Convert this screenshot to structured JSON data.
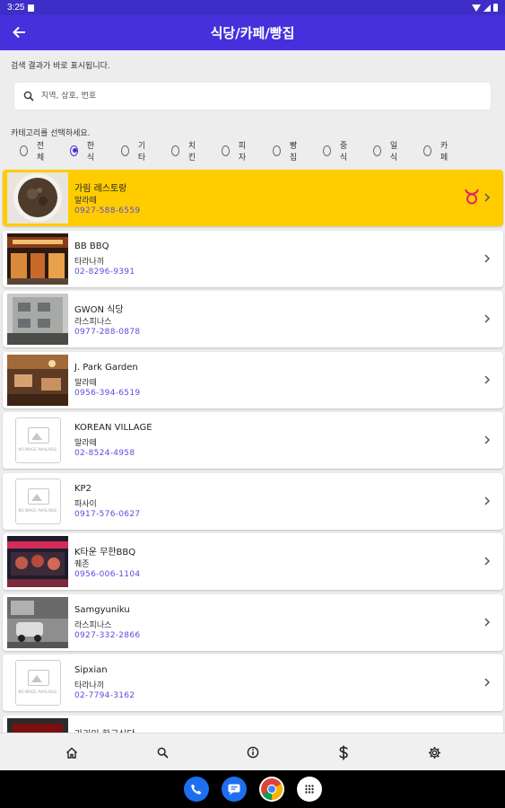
{
  "status_bar": {
    "time": "3:25"
  },
  "app_bar": {
    "title": "식당/카페/빵집"
  },
  "hint": "검색 결과가 바로 표시됩니다.",
  "search": {
    "placeholder": "지역, 상호, 번호",
    "value": ""
  },
  "category_hint": "카테고리를 선택하세요.",
  "categories": [
    {
      "label": "전체",
      "selected": false
    },
    {
      "label": "한식",
      "selected": true
    },
    {
      "label": "기타",
      "selected": false
    },
    {
      "label": "치킨",
      "selected": false
    },
    {
      "label": "피자",
      "selected": false
    },
    {
      "label": "빵집",
      "selected": false
    },
    {
      "label": "중식",
      "selected": false
    },
    {
      "label": "일식",
      "selected": false
    },
    {
      "label": "카페",
      "selected": false
    }
  ],
  "no_image_text": "NO IMAGE AVAILABLE",
  "restaurants": [
    {
      "name": "가림 레스토랑",
      "region": "말라떼",
      "phone": "0927-588-6559",
      "highlighted": true,
      "thumb": "food-photo",
      "badge": "taurus-icon"
    },
    {
      "name": "BB BBQ",
      "region": "타라나끼",
      "phone": "02-8296-9391",
      "highlighted": false,
      "thumb": "storefront-photo"
    },
    {
      "name": "GWON 식당",
      "region": "라스피나스",
      "phone": "0977-288-0878",
      "highlighted": false,
      "thumb": "building-photo"
    },
    {
      "name": "J. Park Garden",
      "region": "말라떼",
      "phone": "0956-394-6519",
      "highlighted": false,
      "thumb": "interior-photo"
    },
    {
      "name": "KOREAN VILLAGE",
      "region": "말라떼",
      "phone": "02-8524-4958",
      "highlighted": false,
      "thumb": "no-image"
    },
    {
      "name": "KP2",
      "region": "파사이",
      "phone": "0917-576-0627",
      "highlighted": false,
      "thumb": "no-image"
    },
    {
      "name": "K타운 무한BBQ",
      "region": "퀘존",
      "phone": "0956-006-1104",
      "highlighted": false,
      "thumb": "bbq-photo"
    },
    {
      "name": "Samgyuniku",
      "region": "라스피나스",
      "phone": "0927-332-2866",
      "highlighted": false,
      "thumb": "street-photo"
    },
    {
      "name": "Sipxian",
      "region": "타라나끼",
      "phone": "02-7794-3162",
      "highlighted": false,
      "thumb": "no-image"
    },
    {
      "name": "가리미 한국식당",
      "region": "",
      "phone": "",
      "highlighted": false,
      "thumb": "dark-photo"
    }
  ],
  "bottom_nav": [
    "home-icon",
    "search-icon",
    "info-icon",
    "dollar-icon",
    "settings-icon"
  ],
  "dock": [
    "phone-app-icon",
    "messages-app-icon",
    "chrome-app-icon",
    "app-drawer-icon"
  ],
  "colors": {
    "primary": "#4530dc",
    "highlight": "#ffcc00",
    "phone_text": "#5b4be0"
  }
}
